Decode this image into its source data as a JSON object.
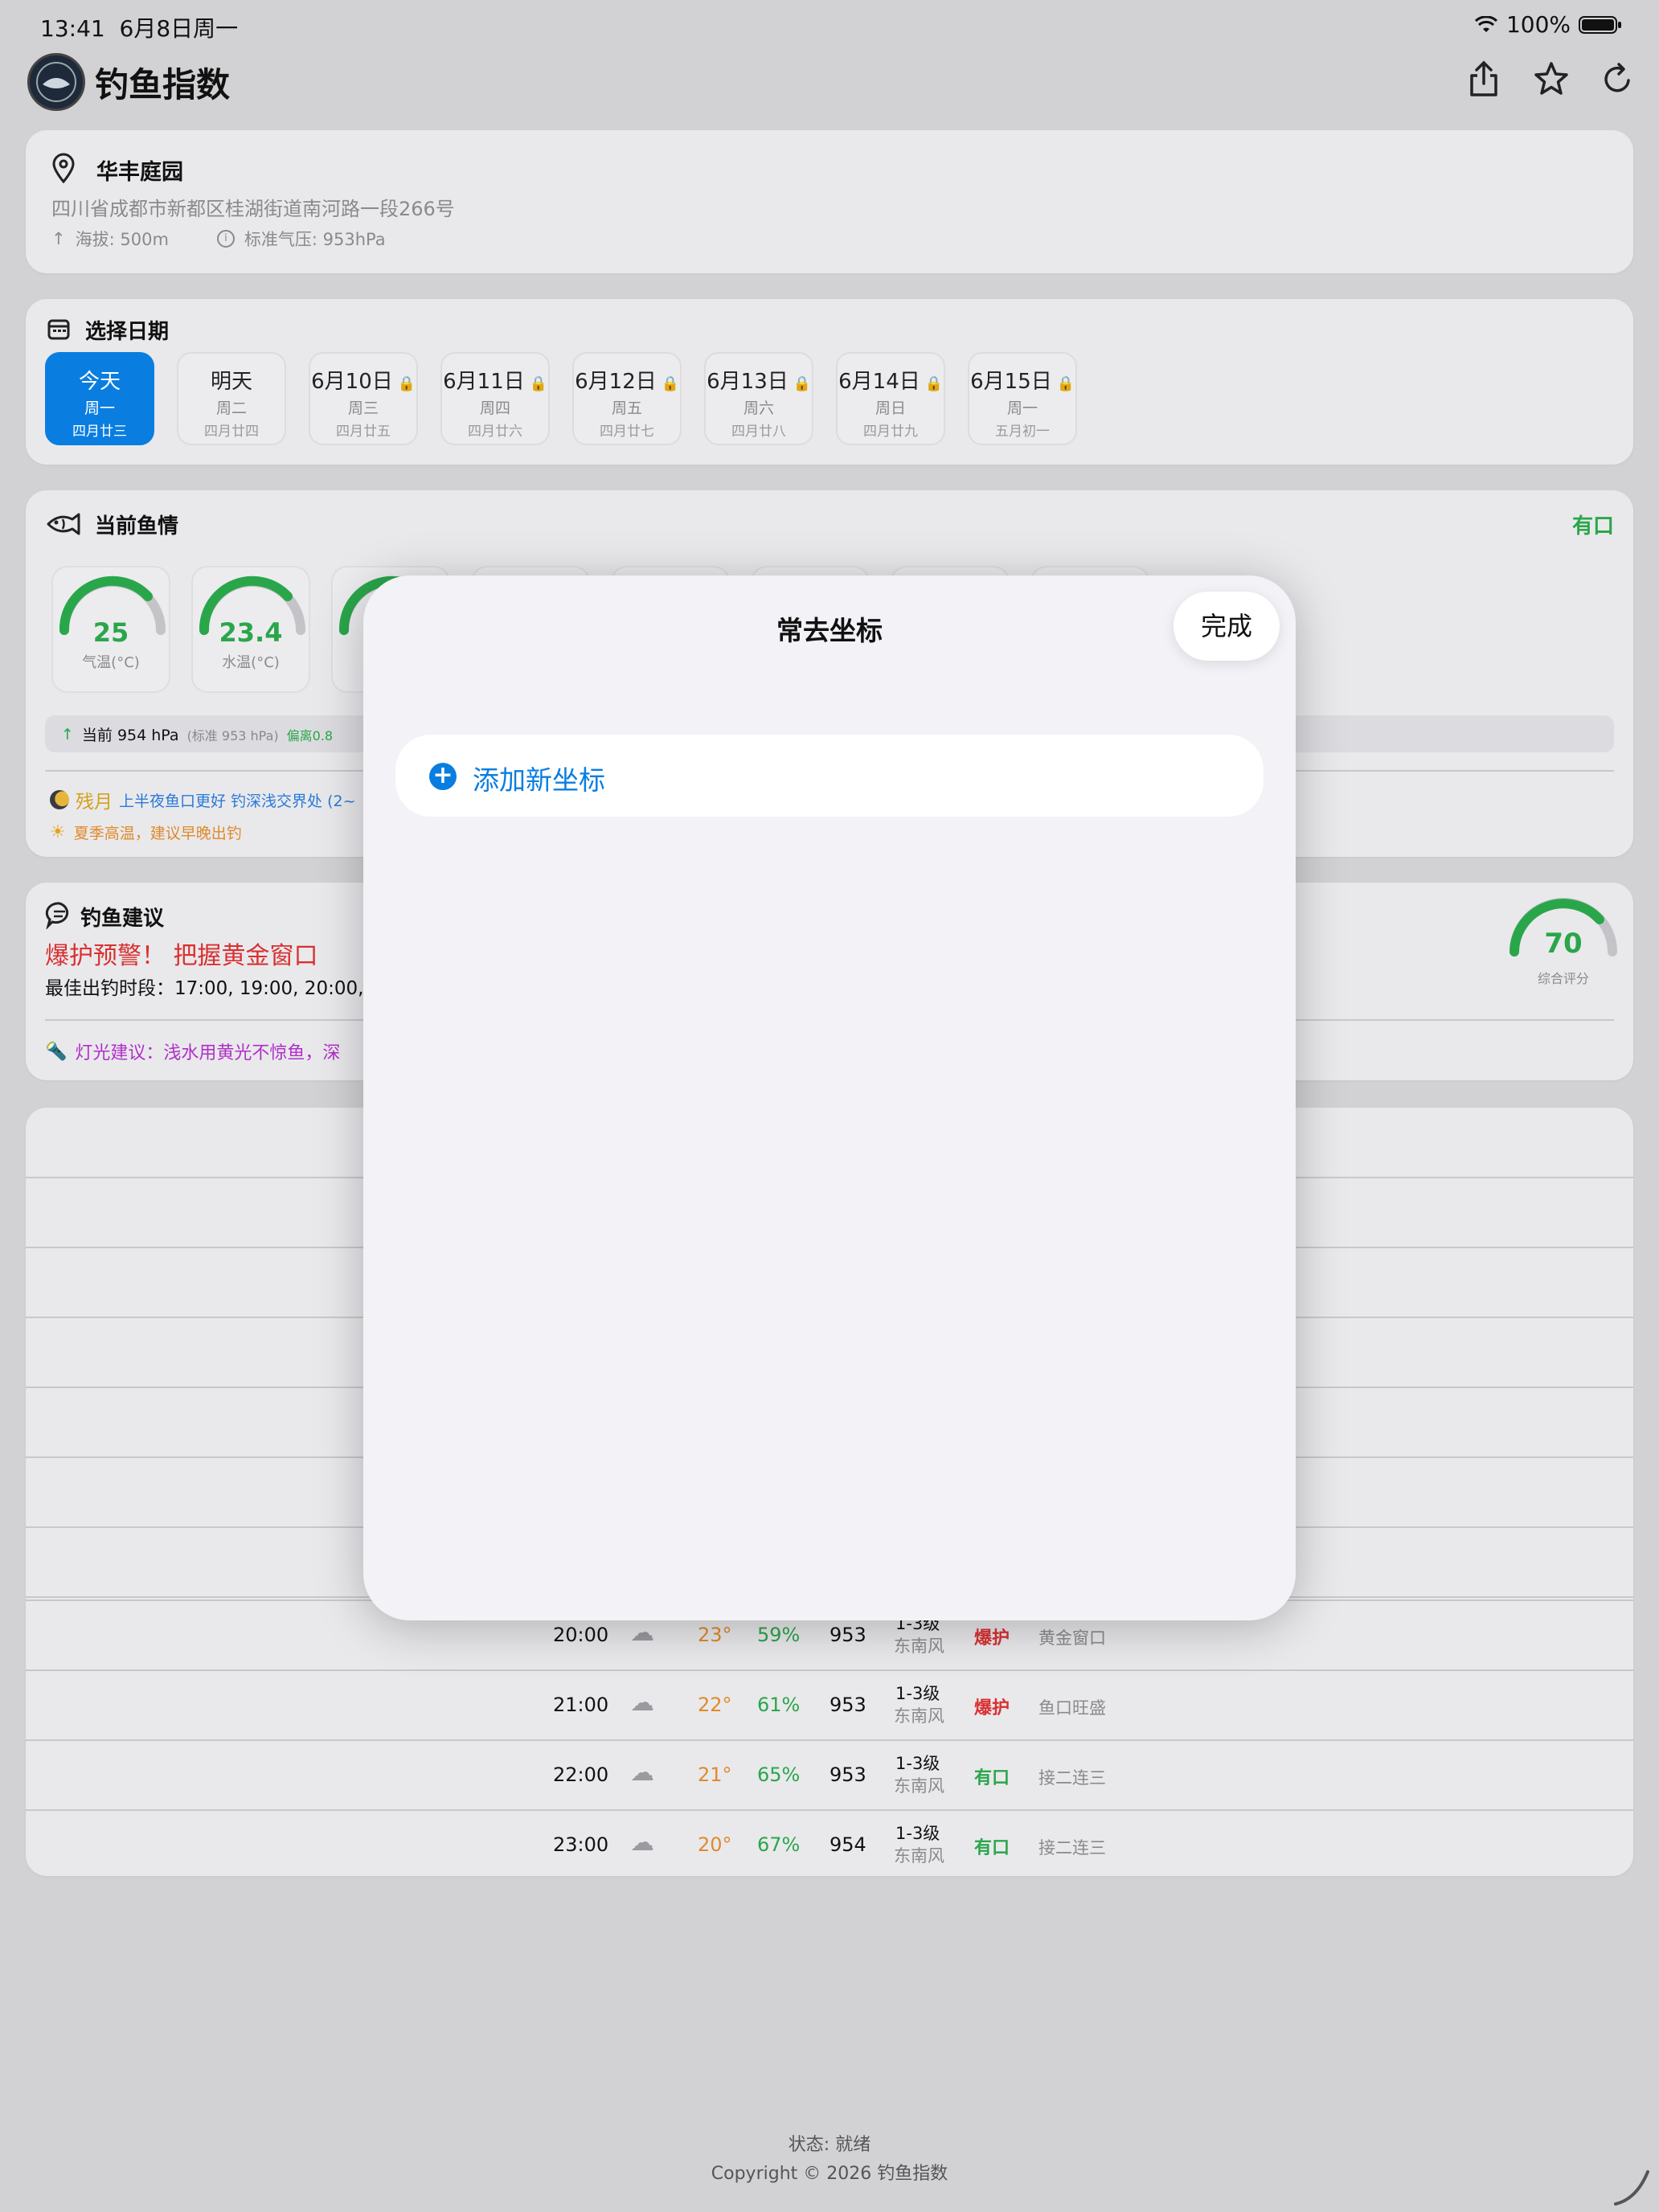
{
  "status_bar": {
    "time": "13:41",
    "date": "6月8日周一",
    "battery": "100%"
  },
  "header": {
    "title": "钓鱼指数"
  },
  "location": {
    "name": "华丰庭园",
    "address": "四川省成都市新都区桂湖街道南河路一段266号",
    "altitude": "海拔: 500m",
    "pressure": "标准气压: 953hPa"
  },
  "date_section": {
    "title": "选择日期",
    "days": [
      {
        "day": "今天",
        "weekday": "周一",
        "lunar": "四月廿三",
        "locked": false
      },
      {
        "day": "明天",
        "weekday": "周二",
        "lunar": "四月廿四",
        "locked": false
      },
      {
        "day": "6月10日",
        "weekday": "周三",
        "lunar": "四月廿五",
        "locked": true
      },
      {
        "day": "6月11日",
        "weekday": "周四",
        "lunar": "四月廿六",
        "locked": true
      },
      {
        "day": "6月12日",
        "weekday": "周五",
        "lunar": "四月廿七",
        "locked": true
      },
      {
        "day": "6月13日",
        "weekday": "周六",
        "lunar": "四月廿八",
        "locked": true
      },
      {
        "day": "6月14日",
        "weekday": "周日",
        "lunar": "四月廿九",
        "locked": true
      },
      {
        "day": "6月15日",
        "weekday": "周一",
        "lunar": "五月初一",
        "locked": true
      }
    ]
  },
  "fish_section": {
    "title": "当前鱼情",
    "status": "有口",
    "gauges": [
      {
        "value": "25",
        "label": "气温(°C)"
      },
      {
        "value": "23.4",
        "label": "水温(°C)"
      }
    ],
    "pressure_current": "当前 954 hPa",
    "pressure_standard": "(标准 953 hPa)",
    "pressure_deviation": "偏离0.8",
    "moon_name": "残月",
    "moon_tip": "上半夜鱼口更好 钓深浅交界处 (2~",
    "heat_tip": "夏季高温，建议早晚出钓"
  },
  "advice_section": {
    "title": "钓鱼建议",
    "alert": "爆护预警！ 把握黄金窗口",
    "best_times": "最佳出钓时段：17:00, 19:00, 20:00,",
    "score": "70",
    "score_label": "综合评分",
    "light_tip": "灯光建议：浅水用黄光不惊鱼，深"
  },
  "hourly": [
    {
      "time": "20:00",
      "temp": "23°",
      "humidity": "59%",
      "pressure": "953",
      "wind_level": "1-3级",
      "wind_dir": "东南风",
      "status": "爆护",
      "note": "黄金窗口"
    },
    {
      "time": "21:00",
      "temp": "22°",
      "humidity": "61%",
      "pressure": "953",
      "wind_level": "1-3级",
      "wind_dir": "东南风",
      "status": "爆护",
      "note": "鱼口旺盛"
    },
    {
      "time": "22:00",
      "temp": "21°",
      "humidity": "65%",
      "pressure": "953",
      "wind_level": "1-3级",
      "wind_dir": "东南风",
      "status": "有口",
      "note": "接二连三"
    },
    {
      "time": "23:00",
      "temp": "20°",
      "humidity": "67%",
      "pressure": "954",
      "wind_level": "1-3级",
      "wind_dir": "东南风",
      "status": "有口",
      "note": "接二连三"
    }
  ],
  "footer": {
    "status": "状态: 就绪",
    "copyright": "Copyright © 2026 钓鱼指数"
  },
  "modal": {
    "title": "常去坐标",
    "done_label": "完成",
    "add_label": "添加新坐标"
  },
  "colors": {
    "accent": "#0a7ee0",
    "good": "#2aa64a",
    "alert": "#d93030",
    "warm": "#e08a2a"
  }
}
